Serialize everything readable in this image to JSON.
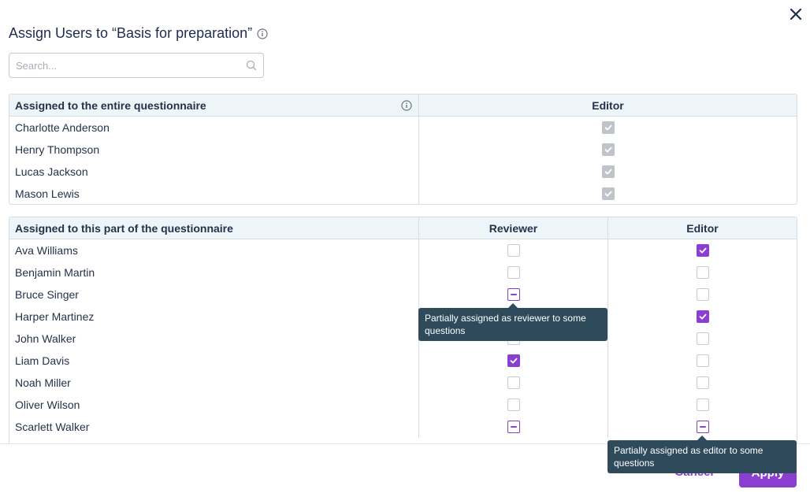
{
  "dialog": {
    "title": "Assign Users to “Basis for preparation”",
    "close_icon": "close-icon",
    "info_icon": "info-icon"
  },
  "search": {
    "placeholder": "Search...",
    "value": "",
    "icon": "search-icon"
  },
  "entire_table": {
    "header": "Assigned to the entire questionnaire",
    "header_info_icon": "info-icon",
    "columns": [
      "Editor"
    ],
    "rows": [
      {
        "name": "Charlotte Anderson",
        "editor": "checked-disabled"
      },
      {
        "name": "Henry Thompson",
        "editor": "checked-disabled"
      },
      {
        "name": "Lucas Jackson",
        "editor": "checked-disabled"
      },
      {
        "name": "Mason Lewis",
        "editor": "checked-disabled"
      }
    ]
  },
  "part_table": {
    "header": "Assigned to this part of the questionnaire",
    "columns": [
      "Reviewer",
      "Editor"
    ],
    "rows": [
      {
        "name": "Ava Williams",
        "reviewer": "unchecked",
        "editor": "checked"
      },
      {
        "name": "Benjamin Martin",
        "reviewer": "unchecked",
        "editor": "unchecked"
      },
      {
        "name": "Bruce Singer",
        "reviewer": "partial",
        "editor": "unchecked"
      },
      {
        "name": "Harper Martinez",
        "reviewer": "unchecked",
        "editor": "checked"
      },
      {
        "name": "John Walker",
        "reviewer": "unchecked",
        "editor": "unchecked"
      },
      {
        "name": "Liam Davis",
        "reviewer": "checked",
        "editor": "unchecked"
      },
      {
        "name": "Noah Miller",
        "reviewer": "unchecked",
        "editor": "unchecked"
      },
      {
        "name": "Oliver Wilson",
        "reviewer": "unchecked",
        "editor": "unchecked"
      },
      {
        "name": "Scarlett Walker",
        "reviewer": "partial",
        "editor": "partial"
      }
    ]
  },
  "tooltips": {
    "reviewer_partial": "Partially assigned as reviewer to some questions",
    "editor_partial": "Partially assigned as editor to some questions"
  },
  "footer": {
    "cancel_label": "Cancel",
    "apply_label": "Apply"
  },
  "colors": {
    "accent": "#8a3fd1",
    "tooltip_bg": "#2f4a5a",
    "header_bg": "#eef5f8"
  }
}
